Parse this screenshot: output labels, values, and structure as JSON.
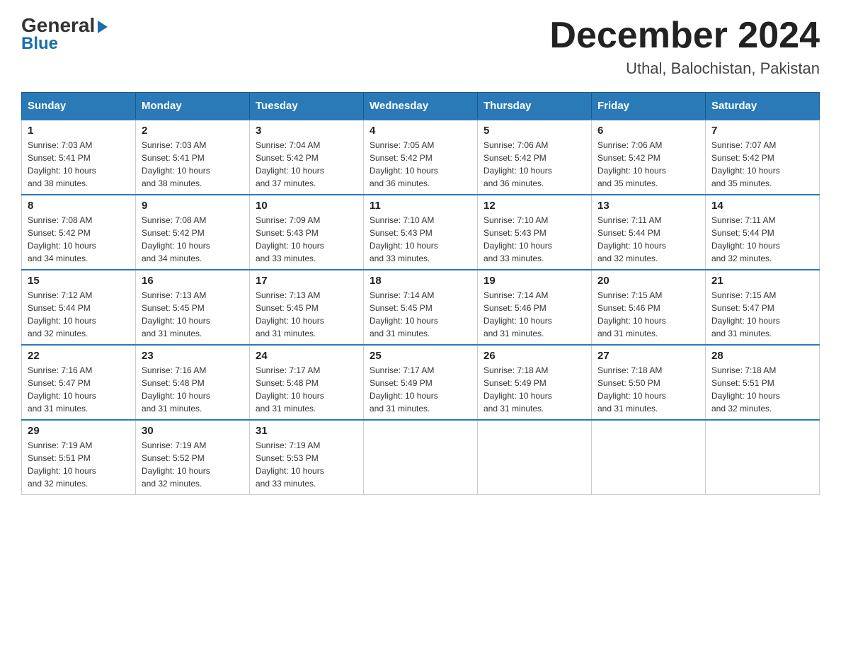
{
  "header": {
    "logo_general": "General",
    "logo_blue": "Blue",
    "month_title": "December 2024",
    "subtitle": "Uthal, Balochistan, Pakistan"
  },
  "days_of_week": [
    "Sunday",
    "Monday",
    "Tuesday",
    "Wednesday",
    "Thursday",
    "Friday",
    "Saturday"
  ],
  "weeks": [
    [
      {
        "day": "1",
        "sunrise": "7:03 AM",
        "sunset": "5:41 PM",
        "daylight": "10 hours and 38 minutes."
      },
      {
        "day": "2",
        "sunrise": "7:03 AM",
        "sunset": "5:41 PM",
        "daylight": "10 hours and 38 minutes."
      },
      {
        "day": "3",
        "sunrise": "7:04 AM",
        "sunset": "5:42 PM",
        "daylight": "10 hours and 37 minutes."
      },
      {
        "day": "4",
        "sunrise": "7:05 AM",
        "sunset": "5:42 PM",
        "daylight": "10 hours and 36 minutes."
      },
      {
        "day": "5",
        "sunrise": "7:06 AM",
        "sunset": "5:42 PM",
        "daylight": "10 hours and 36 minutes."
      },
      {
        "day": "6",
        "sunrise": "7:06 AM",
        "sunset": "5:42 PM",
        "daylight": "10 hours and 35 minutes."
      },
      {
        "day": "7",
        "sunrise": "7:07 AM",
        "sunset": "5:42 PM",
        "daylight": "10 hours and 35 minutes."
      }
    ],
    [
      {
        "day": "8",
        "sunrise": "7:08 AM",
        "sunset": "5:42 PM",
        "daylight": "10 hours and 34 minutes."
      },
      {
        "day": "9",
        "sunrise": "7:08 AM",
        "sunset": "5:42 PM",
        "daylight": "10 hours and 34 minutes."
      },
      {
        "day": "10",
        "sunrise": "7:09 AM",
        "sunset": "5:43 PM",
        "daylight": "10 hours and 33 minutes."
      },
      {
        "day": "11",
        "sunrise": "7:10 AM",
        "sunset": "5:43 PM",
        "daylight": "10 hours and 33 minutes."
      },
      {
        "day": "12",
        "sunrise": "7:10 AM",
        "sunset": "5:43 PM",
        "daylight": "10 hours and 33 minutes."
      },
      {
        "day": "13",
        "sunrise": "7:11 AM",
        "sunset": "5:44 PM",
        "daylight": "10 hours and 32 minutes."
      },
      {
        "day": "14",
        "sunrise": "7:11 AM",
        "sunset": "5:44 PM",
        "daylight": "10 hours and 32 minutes."
      }
    ],
    [
      {
        "day": "15",
        "sunrise": "7:12 AM",
        "sunset": "5:44 PM",
        "daylight": "10 hours and 32 minutes."
      },
      {
        "day": "16",
        "sunrise": "7:13 AM",
        "sunset": "5:45 PM",
        "daylight": "10 hours and 31 minutes."
      },
      {
        "day": "17",
        "sunrise": "7:13 AM",
        "sunset": "5:45 PM",
        "daylight": "10 hours and 31 minutes."
      },
      {
        "day": "18",
        "sunrise": "7:14 AM",
        "sunset": "5:45 PM",
        "daylight": "10 hours and 31 minutes."
      },
      {
        "day": "19",
        "sunrise": "7:14 AM",
        "sunset": "5:46 PM",
        "daylight": "10 hours and 31 minutes."
      },
      {
        "day": "20",
        "sunrise": "7:15 AM",
        "sunset": "5:46 PM",
        "daylight": "10 hours and 31 minutes."
      },
      {
        "day": "21",
        "sunrise": "7:15 AM",
        "sunset": "5:47 PM",
        "daylight": "10 hours and 31 minutes."
      }
    ],
    [
      {
        "day": "22",
        "sunrise": "7:16 AM",
        "sunset": "5:47 PM",
        "daylight": "10 hours and 31 minutes."
      },
      {
        "day": "23",
        "sunrise": "7:16 AM",
        "sunset": "5:48 PM",
        "daylight": "10 hours and 31 minutes."
      },
      {
        "day": "24",
        "sunrise": "7:17 AM",
        "sunset": "5:48 PM",
        "daylight": "10 hours and 31 minutes."
      },
      {
        "day": "25",
        "sunrise": "7:17 AM",
        "sunset": "5:49 PM",
        "daylight": "10 hours and 31 minutes."
      },
      {
        "day": "26",
        "sunrise": "7:18 AM",
        "sunset": "5:49 PM",
        "daylight": "10 hours and 31 minutes."
      },
      {
        "day": "27",
        "sunrise": "7:18 AM",
        "sunset": "5:50 PM",
        "daylight": "10 hours and 31 minutes."
      },
      {
        "day": "28",
        "sunrise": "7:18 AM",
        "sunset": "5:51 PM",
        "daylight": "10 hours and 32 minutes."
      }
    ],
    [
      {
        "day": "29",
        "sunrise": "7:19 AM",
        "sunset": "5:51 PM",
        "daylight": "10 hours and 32 minutes."
      },
      {
        "day": "30",
        "sunrise": "7:19 AM",
        "sunset": "5:52 PM",
        "daylight": "10 hours and 32 minutes."
      },
      {
        "day": "31",
        "sunrise": "7:19 AM",
        "sunset": "5:53 PM",
        "daylight": "10 hours and 33 minutes."
      },
      null,
      null,
      null,
      null
    ]
  ],
  "labels": {
    "sunrise": "Sunrise:",
    "sunset": "Sunset:",
    "daylight": "Daylight:"
  }
}
